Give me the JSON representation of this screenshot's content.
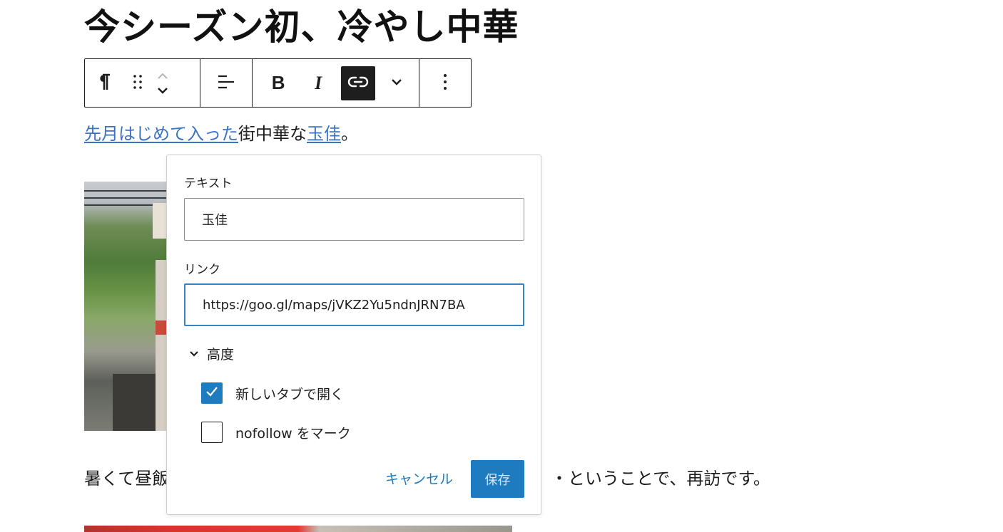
{
  "post": {
    "title": "今シーズン初、冷やし中華",
    "para1": {
      "link1": "先月はじめて入った",
      "middle": "街中華な",
      "link2": "玉佳",
      "end": "。"
    },
    "para2_start": "暑くて昼飯",
    "para2_end": "・ということで、再訪です。"
  },
  "toolbar": {
    "icons": [
      "pilcrow-icon",
      "drag-handle-icon",
      "chevron-up-icon",
      "chevron-down-icon",
      "align-left-icon",
      "bold-icon",
      "italic-icon",
      "link-icon",
      "more-rich-text-chevron-icon",
      "options-kebab-icon"
    ],
    "bold_label": "B",
    "italic_label": "I"
  },
  "link_popover": {
    "text_label": "テキスト",
    "text_value": "玉佳",
    "link_label": "リンク",
    "link_value": "https://goo.gl/maps/jVKZ2Yu5ndnJRN7BA",
    "advanced_label": "高度",
    "open_new_tab_label": "新しいタブで開く",
    "open_new_tab_checked": true,
    "nofollow_label": "nofollow をマーク",
    "nofollow_checked": false,
    "cancel_label": "キャンセル",
    "save_label": "保存"
  },
  "colors": {
    "accent": "#1e7bbf",
    "link_text": "#3a73c2",
    "dark": "#1e1e1e"
  }
}
